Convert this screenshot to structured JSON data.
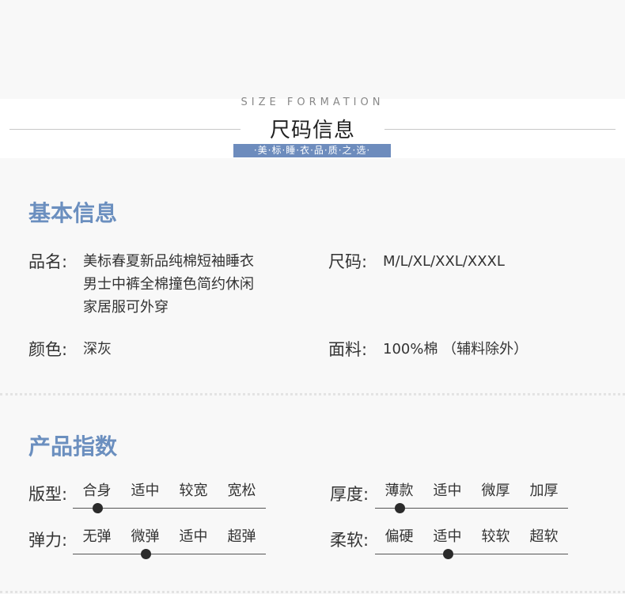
{
  "header": {
    "en_title": "SIZE FORMATION",
    "cn_title": "尺码信息",
    "tagline": "·美·标·睡·衣·品·质·之·选·"
  },
  "basic": {
    "title": "基本信息",
    "name_label": "品名:",
    "name_lines": [
      "美标春夏新品纯棉短袖睡衣",
      "男士中裤全棉撞色简约休闲",
      "家居服可外穿"
    ],
    "size_label": "尺码:",
    "size_value": "M/L/XL/XXL/XXXL",
    "color_label": "颜色:",
    "color_value": "深灰",
    "fabric_label": "面料:",
    "fabric_value": "100%棉 （辅料除外）"
  },
  "index": {
    "title": "产品指数",
    "scales": [
      {
        "label": "版型:",
        "options": [
          "合身",
          "适中",
          "较宽",
          "宽松"
        ],
        "selected": 0
      },
      {
        "label": "厚度:",
        "options": [
          "薄款",
          "适中",
          "微厚",
          "加厚"
        ],
        "selected": 0
      },
      {
        "label": "弹力:",
        "options": [
          "无弹",
          "微弹",
          "适中",
          "超弹"
        ],
        "selected": 1
      },
      {
        "label": "柔软:",
        "options": [
          "偏硬",
          "适中",
          "较软",
          "超软"
        ],
        "selected": 1
      }
    ]
  }
}
